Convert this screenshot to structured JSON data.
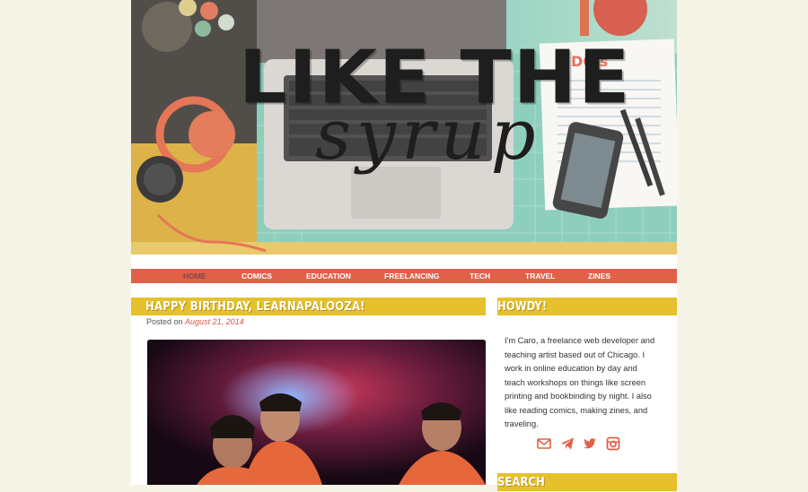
{
  "site": {
    "title_line1": "LIKE THE",
    "title_line2": "syrup"
  },
  "nav": {
    "items": [
      {
        "label": "HOME",
        "current": true
      },
      {
        "label": "COMICS",
        "current": false
      },
      {
        "label": "EDUCATION",
        "current": false
      },
      {
        "label": "FREELANCING",
        "current": false
      },
      {
        "label": "TECH",
        "current": false
      },
      {
        "label": "TRAVEL",
        "current": false
      },
      {
        "label": "ZINES",
        "current": false
      }
    ]
  },
  "post": {
    "title": "HAPPY BIRTHDAY, LEARNAPALOOZA!",
    "posted_on_label": "Posted on",
    "date": "August 21, 2014"
  },
  "sidebar": {
    "howdy_title": "HOWDY!",
    "howdy_text": "I'm Caro, a freelance web developer and teaching artist based out of Chicago. I work in online education by day and teach workshops on things like screen printing and bookbinding by night. I also like reading comics, making zines, and traveling.",
    "search_title": "SEARCH",
    "social_icons": [
      "mail-icon",
      "paper-plane-icon",
      "twitter-icon",
      "instagram-icon"
    ]
  },
  "colors": {
    "page_bg": "#f6f3e7",
    "nav_bg": "#e0604a",
    "nav_current": "#7d4a48",
    "title_bar": "#e6c12b",
    "accent_link": "#d9573e"
  }
}
